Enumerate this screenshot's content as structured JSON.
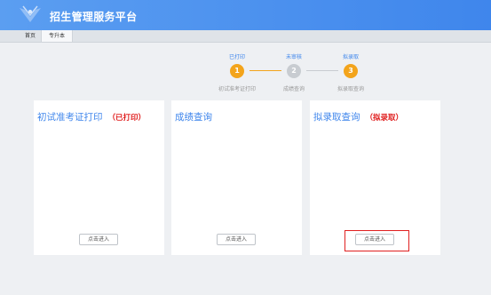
{
  "header": {
    "title": "招生管理服务平台",
    "logo_icon": "emblem-icon",
    "color": "#4a8fee"
  },
  "tabs": [
    {
      "label": "首页"
    },
    {
      "label": "专升本"
    }
  ],
  "steps": [
    {
      "status": "已打印",
      "number": "1",
      "label": "初试准考证打印",
      "state": "done"
    },
    {
      "status": "未审核",
      "number": "2",
      "label": "成绩查询",
      "state": "pending"
    },
    {
      "status": "拟录取",
      "number": "3",
      "label": "拟录取查询",
      "state": "done"
    }
  ],
  "cards": [
    {
      "title": "初试准考证打印",
      "tag": "（已打印）",
      "button": "点击进入"
    },
    {
      "title": "成绩查询",
      "tag": "",
      "button": "点击进入"
    },
    {
      "title": "拟录取查询",
      "tag": "（拟录取）",
      "button": "点击进入"
    }
  ],
  "colors": {
    "accent": "#3f86ec",
    "step": "#f3a41b",
    "tag": "#e02020"
  }
}
